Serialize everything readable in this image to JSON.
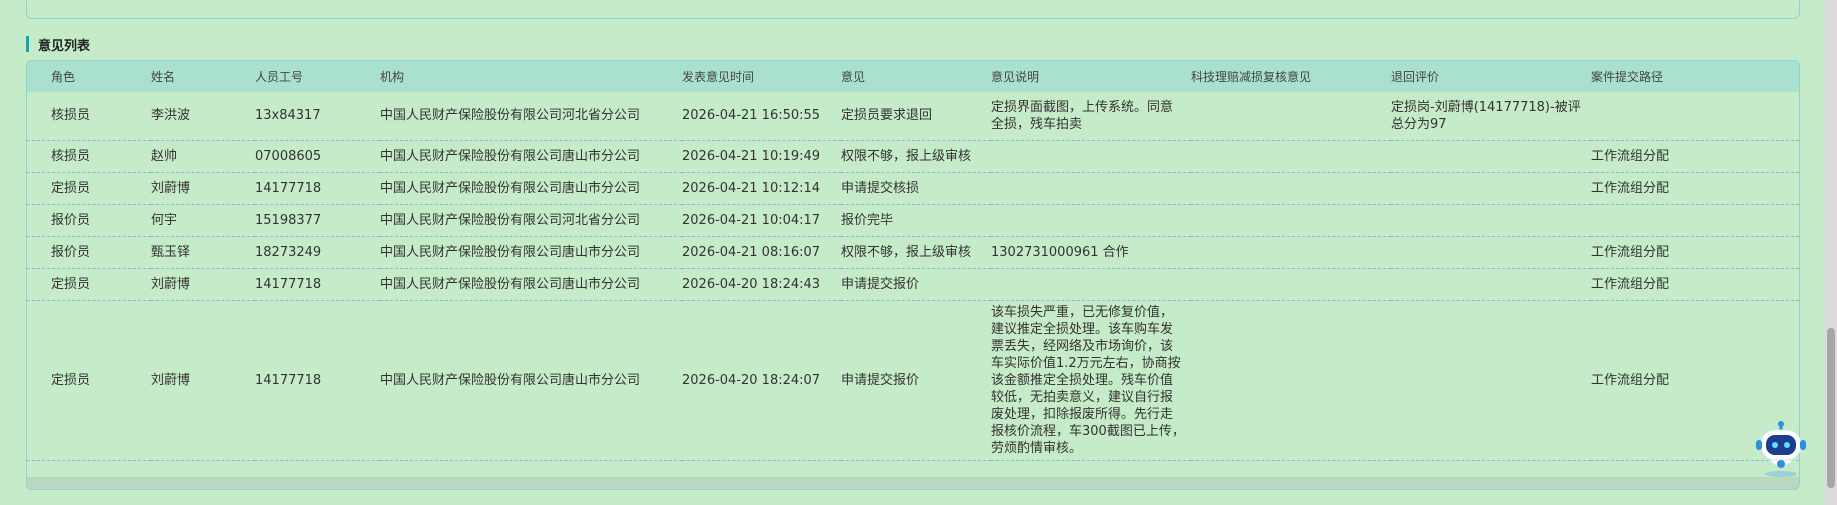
{
  "section": {
    "title": "意见列表"
  },
  "table": {
    "headers": [
      "角色",
      "姓名",
      "人员工号",
      "机构",
      "发表意见时间",
      "意见",
      "意见说明",
      "科技理赔减损复核意见",
      "退回评价",
      "案件提交路径"
    ],
    "rows": [
      [
        "核损员",
        "李洪波",
        "13x84317",
        "中国人民财产保险股份有限公司河北省分公司",
        "2026-04-21 16:50:55",
        "定损员要求退回",
        "定损界面截图，上传系统。同意全损，残车拍卖",
        "",
        "定损岗-刘蔚博(14177718)-被评总分为97",
        ""
      ],
      [
        "核损员",
        "赵帅",
        "07008605",
        "中国人民财产保险股份有限公司唐山市分公司",
        "2026-04-21 10:19:49",
        "权限不够，报上级审核",
        "",
        "",
        "",
        "工作流组分配"
      ],
      [
        "定损员",
        "刘蔚博",
        "14177718",
        "中国人民财产保险股份有限公司唐山市分公司",
        "2026-04-21 10:12:14",
        "申请提交核损",
        "",
        "",
        "",
        "工作流组分配"
      ],
      [
        "报价员",
        "何宇",
        "15198377",
        "中国人民财产保险股份有限公司河北省分公司",
        "2026-04-21 10:04:17",
        "报价完毕",
        "",
        "",
        "",
        ""
      ],
      [
        "报价员",
        "甄玉铎",
        "18273249",
        "中国人民财产保险股份有限公司唐山市分公司",
        "2026-04-21 08:16:07",
        "权限不够，报上级审核",
        "1302731000961 合作",
        "",
        "",
        "工作流组分配"
      ],
      [
        "定损员",
        "刘蔚博",
        "14177718",
        "中国人民财产保险股份有限公司唐山市分公司",
        "2026-04-20 18:24:43",
        "申请提交报价",
        "",
        "",
        "",
        "工作流组分配"
      ],
      [
        "定损员",
        "刘蔚博",
        "14177718",
        "中国人民财产保险股份有限公司唐山市分公司",
        "2026-04-20 18:24:07",
        "申请提交报价",
        "该车损失严重，已无修复价值，建议推定全损处理。该车购车发票丢失，经网络及市场询价，该车实际价值1.2万元左右，协商按该金额推定全损处理。残车价值较低，无拍卖意义，建议自行报废处理，扣除报废所得。先行走报核价流程，车300截图已上传，劳烦酌情审核。",
        "",
        "",
        "工作流组分配"
      ]
    ]
  },
  "colors": {
    "background": "#c6ebc9",
    "header": "#a9e0d0",
    "accent": "#1aa2b5",
    "row_border": "#80bfd0"
  },
  "assistant": {
    "icon": "robot-assistant-icon"
  }
}
